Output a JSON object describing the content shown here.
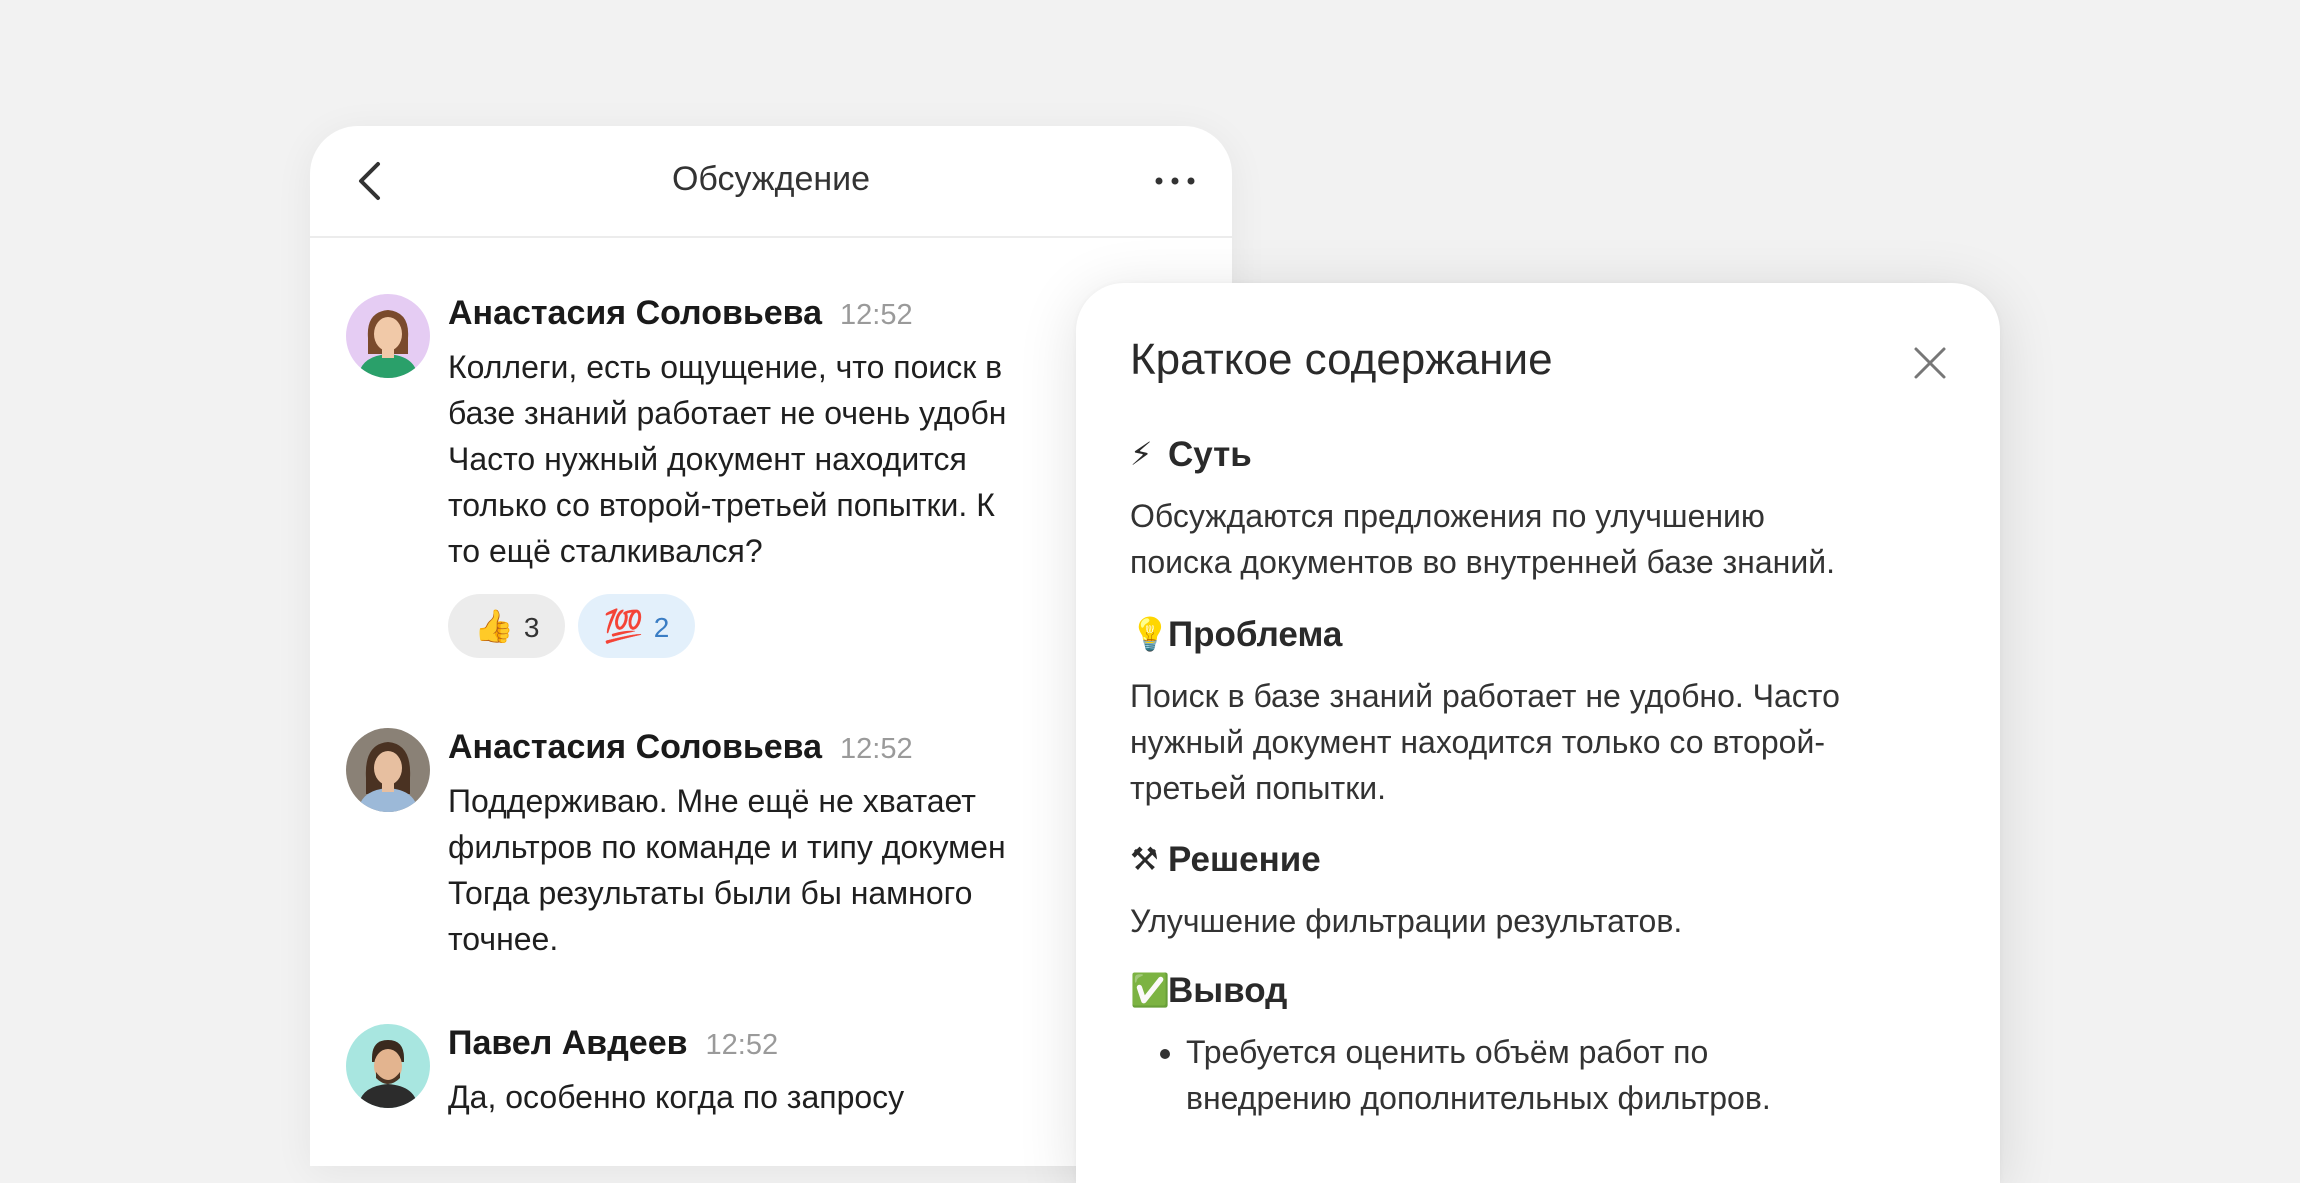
{
  "chat": {
    "title": "Обсуждение",
    "messages": [
      {
        "author": "Анастасия Соловьева",
        "time": "12:52",
        "text": "Коллеги, есть ощущение, что поиск в\nбазе знаний работает не очень удобн\nЧасто нужный документ находится\nтолько со второй-третьей попытки. К\nто ещё сталкивался?",
        "reactions": [
          {
            "emoji": "👍",
            "count": "3"
          },
          {
            "emoji": "💯",
            "count": "2"
          }
        ]
      },
      {
        "author": "Анастасия Соловьева",
        "time": "12:52",
        "text": "Поддерживаю. Мне ещё не хватает\nфильтров по команде и типу докумен\nТогда результаты были бы намного\nточнее."
      },
      {
        "author": "Павел Авдеев",
        "time": "12:52",
        "text": "Да, особенно когда по запросу"
      }
    ]
  },
  "summary": {
    "title": "Краткое содержание",
    "sections": [
      {
        "icon": "⚡",
        "heading": "Суть",
        "text": "Обсуждаются предложения по улучшению\nпоиска документов во внутренней базе знаний."
      },
      {
        "icon": "💡",
        "heading": "Проблема",
        "text": "Поиск в базе знаний работает не удобно. Часто\nнужный документ находится только со второй-\nтретьей попытки."
      },
      {
        "icon": "⚒",
        "heading": "Решение",
        "text": "Улучшение фильтрации результатов."
      },
      {
        "icon": "✅",
        "heading": "Вывод",
        "bullets": [
          "Требуется оценить объём работ по\nвнедрению дополнительных фильтров."
        ]
      }
    ]
  },
  "colors": {
    "background": "#f2f2f2",
    "panel": "#ffffff",
    "time": "#9a9a9a",
    "reaction_grey": "#ececec",
    "reaction_blue": "#e3f0fb"
  }
}
